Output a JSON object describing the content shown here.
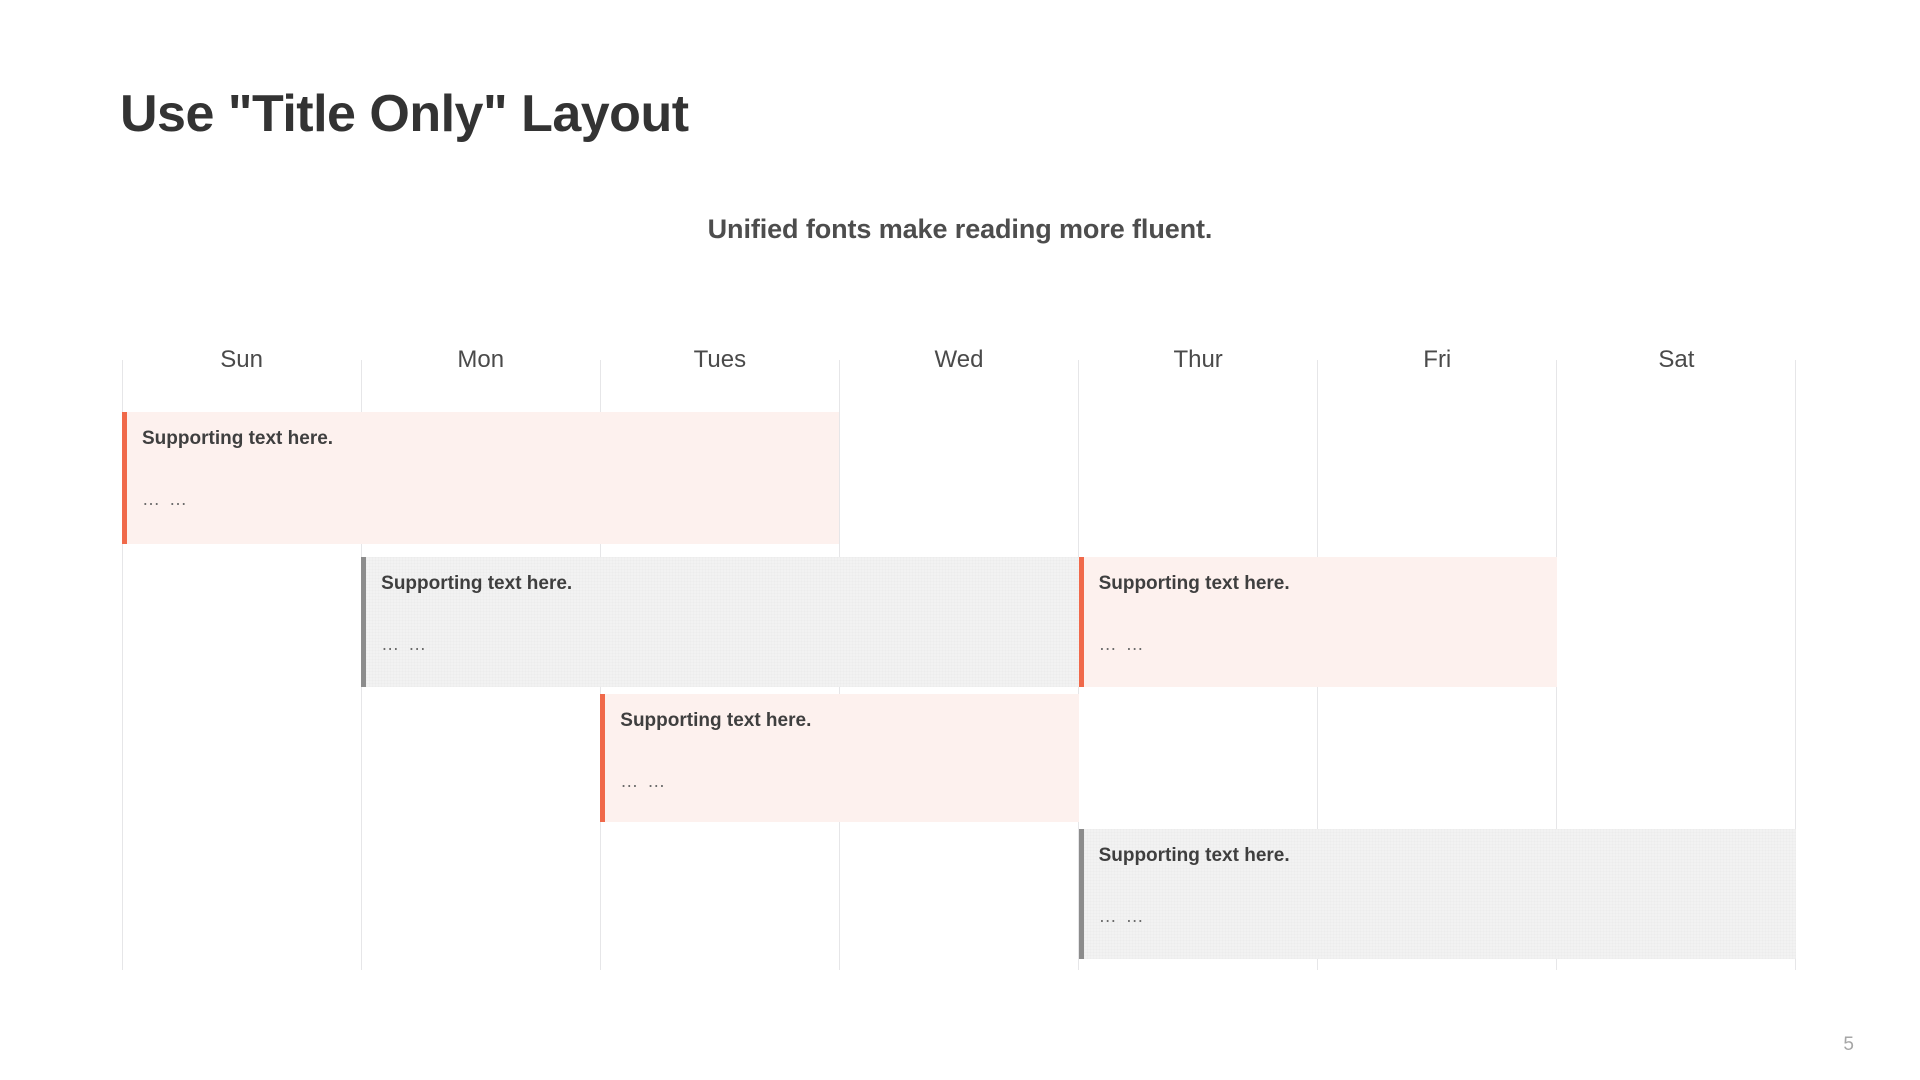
{
  "slide": {
    "title": "Use \"Title Only\" Layout",
    "subtitle": "Unified fonts make reading more fluent.",
    "page_number": "5",
    "background_color": "#ffffff"
  },
  "colors": {
    "title_text": "#333333",
    "subtitle_text": "#4d4d4d",
    "accent_coral": "#f0694a",
    "accent_gray": "#8c8c8c",
    "event_pink_bg": "#fdf1ee",
    "event_gray_bg": "#f2f2f2",
    "grid_line": "#e6e6e8",
    "page_number_text": "#a6a6a6"
  },
  "calendar": {
    "day_headers": [
      {
        "label": "Sun"
      },
      {
        "label": "Mon"
      },
      {
        "label": "Tues"
      },
      {
        "label": "Wed"
      },
      {
        "label": "Thur"
      },
      {
        "label": "Fri"
      },
      {
        "label": "Sat"
      }
    ],
    "events": [
      {
        "title": "Supporting text here.",
        "subtext": "… …",
        "accent_color": "#f0694a",
        "bg_color": "#fdf1ee",
        "start_day": "Sun",
        "end_day": "Tues",
        "textured": false
      },
      {
        "title": "Supporting text here.",
        "subtext": "… …",
        "accent_color": "#8c8c8c",
        "bg_color": "#f2f2f2",
        "start_day": "Mon",
        "end_day": "Wed",
        "textured": true
      },
      {
        "title": "Supporting text here.",
        "subtext": "… …",
        "accent_color": "#f0694a",
        "bg_color": "#fdf1ee",
        "start_day": "Thur",
        "end_day": "Fri",
        "textured": false
      },
      {
        "title": "Supporting text here.",
        "subtext": "… …",
        "accent_color": "#f0694a",
        "bg_color": "#fdf1ee",
        "start_day": "Tues",
        "end_day": "Wed",
        "textured": false
      },
      {
        "title": "Supporting text here.",
        "subtext": "… …",
        "accent_color": "#8c8c8c",
        "bg_color": "#f2f2f2",
        "start_day": "Thur",
        "end_day": "Sat",
        "textured": true
      }
    ]
  }
}
